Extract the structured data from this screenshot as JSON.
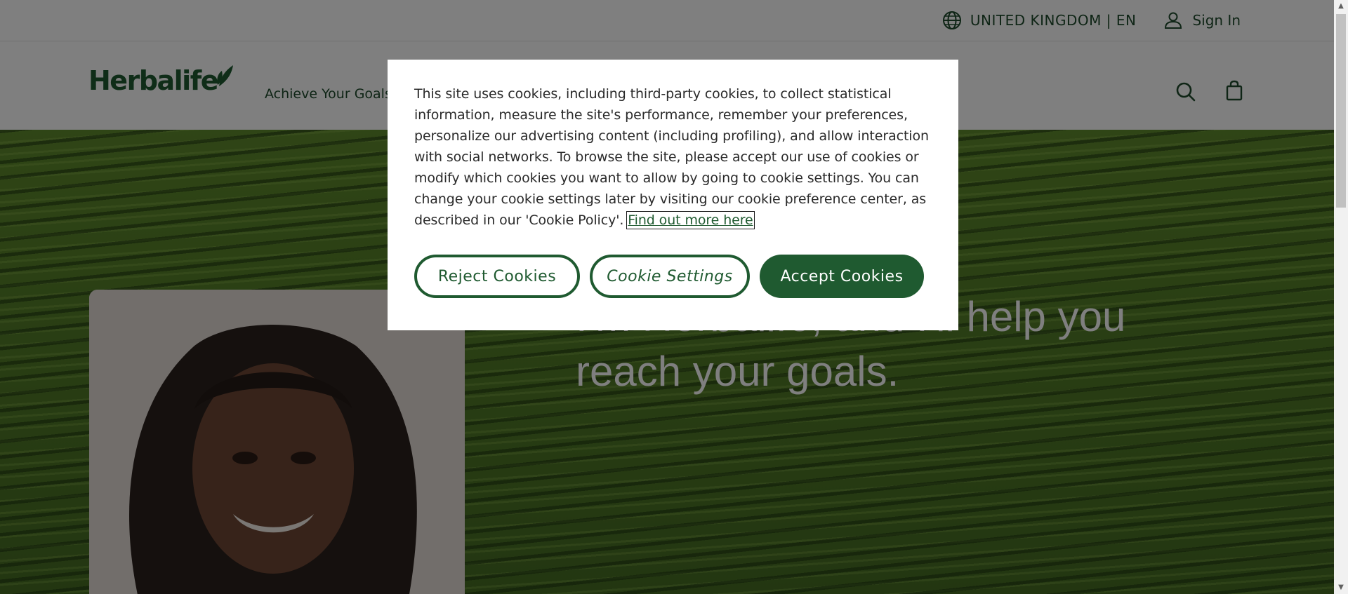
{
  "topbar": {
    "region_label": "UNITED KINGDOM | EN",
    "signin_label": "Sign In"
  },
  "header": {
    "logo_text": "Herbalife",
    "nav_items": [
      "Achieve Your Goals"
    ]
  },
  "hero": {
    "headline": "I'm Herbalife, and I'll help you reach your goals."
  },
  "cookie_modal": {
    "text": "This site uses cookies, including third-party cookies, to collect statistical information, measure the site's performance, remember your preferences, personalize our advertising content (including profiling), and allow interaction with social networks. To browse the site, please accept our use of cookies or modify which cookies you want to allow by going to cookie settings. You can change your cookie settings later by visiting our cookie preference center, as described in our 'Cookie Policy'. ",
    "link_text": "Find out more here",
    "reject_label": "Reject Cookies",
    "settings_label": "Cookie Settings",
    "accept_label": "Accept Cookies"
  },
  "colors": {
    "brand_green": "#1f5a30",
    "overlay": "rgba(0,0,0,0.5)"
  },
  "icons": [
    "globe-icon",
    "user-icon",
    "search-icon",
    "shopping-bag-icon",
    "leaf-icon"
  ]
}
